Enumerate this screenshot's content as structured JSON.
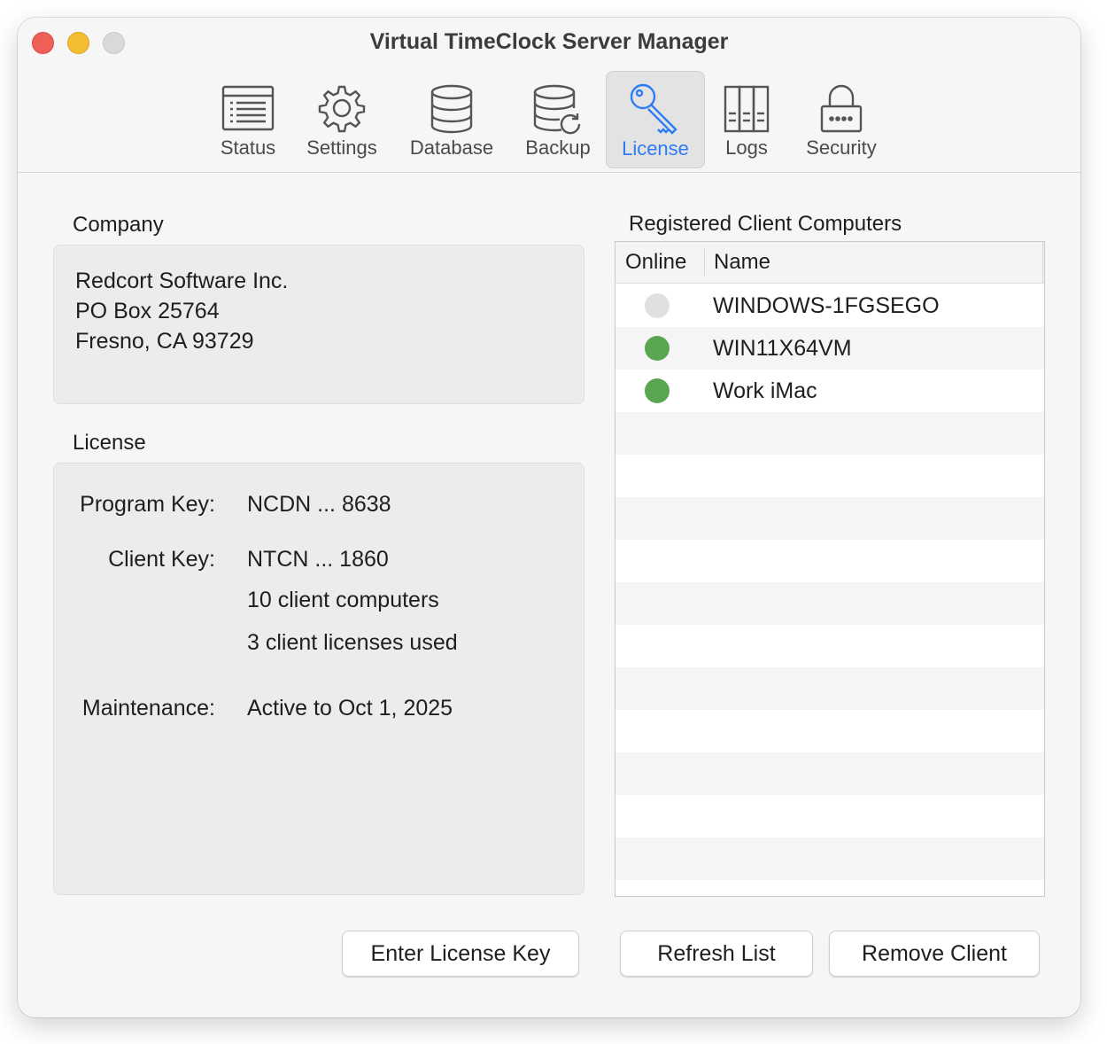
{
  "window": {
    "title": "Virtual TimeClock Server Manager"
  },
  "toolbar": {
    "items": [
      {
        "label": "Status",
        "icon": "status-list-icon"
      },
      {
        "label": "Settings",
        "icon": "gear-icon"
      },
      {
        "label": "Database",
        "icon": "database-icon"
      },
      {
        "label": "Backup",
        "icon": "backup-database-icon"
      },
      {
        "label": "License",
        "icon": "key-icon",
        "selected": true
      },
      {
        "label": "Logs",
        "icon": "logs-binders-icon"
      },
      {
        "label": "Security",
        "icon": "lock-icon"
      }
    ],
    "accent_color": "#2f7bf5"
  },
  "company": {
    "label": "Company",
    "lines": [
      "Redcort Software Inc.",
      "PO Box 25764",
      "Fresno, CA 93729"
    ]
  },
  "license": {
    "label": "License",
    "program_key_label": "Program Key:",
    "program_key": "NCDN ... 8638",
    "client_key_label": "Client Key:",
    "client_key": "NTCN ... 1860",
    "client_computers": "10 client computers",
    "licenses_used": "3 client licenses used",
    "maintenance_label": "Maintenance:",
    "maintenance": "Active to Oct 1, 2025"
  },
  "clients": {
    "label": "Registered Client Computers",
    "columns": [
      "Online",
      "Name"
    ],
    "rows": [
      {
        "online": false,
        "name": "WINDOWS-1FGSEGO"
      },
      {
        "online": true,
        "name": "WIN11X64VM"
      },
      {
        "online": true,
        "name": "Work iMac"
      }
    ],
    "online_color": "#5aa552",
    "offline_color": "#e0e0e0"
  },
  "buttons": {
    "enter_license_key": "Enter License Key",
    "refresh_list": "Refresh List",
    "remove_client": "Remove Client"
  }
}
